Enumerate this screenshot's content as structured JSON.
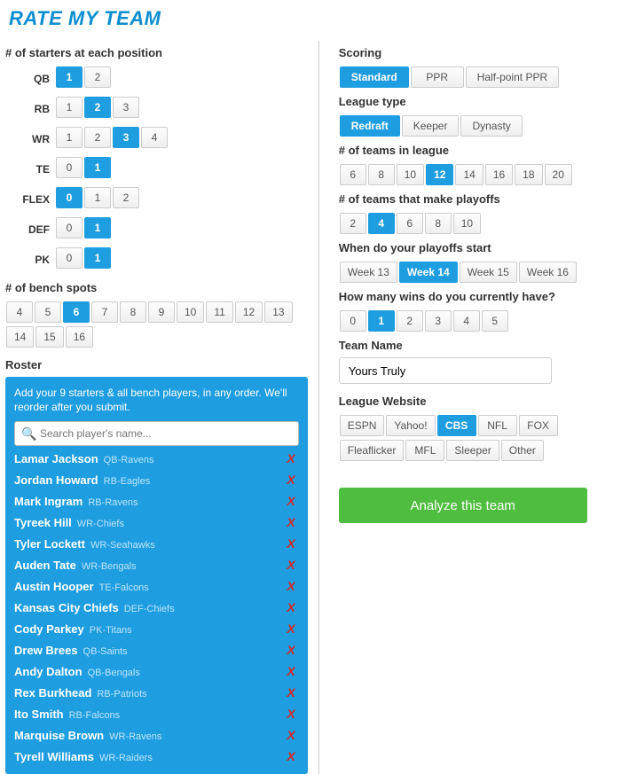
{
  "title": "RATE MY TEAM",
  "left": {
    "starters_label": "# of starters at each position",
    "positions": [
      {
        "name": "QB",
        "options": [
          "1",
          "2"
        ],
        "selected": "1"
      },
      {
        "name": "RB",
        "options": [
          "1",
          "2",
          "3"
        ],
        "selected": "2"
      },
      {
        "name": "WR",
        "options": [
          "1",
          "2",
          "3",
          "4"
        ],
        "selected": "3"
      },
      {
        "name": "TE",
        "options": [
          "0",
          "1"
        ],
        "selected": "1"
      },
      {
        "name": "FLEX",
        "options": [
          "0",
          "1",
          "2"
        ],
        "selected": "0"
      },
      {
        "name": "DEF",
        "options": [
          "0",
          "1"
        ],
        "selected": "1"
      },
      {
        "name": "PK",
        "options": [
          "0",
          "1"
        ],
        "selected": "1"
      }
    ],
    "bench_label": "# of bench spots",
    "bench": {
      "options": [
        "4",
        "5",
        "6",
        "7",
        "8",
        "9",
        "10",
        "11",
        "12",
        "13",
        "14",
        "15",
        "16"
      ],
      "selected": "6"
    },
    "roster_label": "Roster",
    "roster_help": "Add your 9 starters & all bench players, in any order. We'll reorder after you submit.",
    "search_placeholder": "Search player's name...",
    "players": [
      {
        "name": "Lamar Jackson",
        "meta": "QB-Ravens"
      },
      {
        "name": "Jordan Howard",
        "meta": "RB-Eagles"
      },
      {
        "name": "Mark Ingram",
        "meta": "RB-Ravens"
      },
      {
        "name": "Tyreek Hill",
        "meta": "WR-Chiefs"
      },
      {
        "name": "Tyler Lockett",
        "meta": "WR-Seahawks"
      },
      {
        "name": "Auden Tate",
        "meta": "WR-Bengals"
      },
      {
        "name": "Austin Hooper",
        "meta": "TE-Falcons"
      },
      {
        "name": "Kansas City Chiefs",
        "meta": "DEF-Chiefs"
      },
      {
        "name": "Cody Parkey",
        "meta": "PK-Titans"
      },
      {
        "name": "Drew Brees",
        "meta": "QB-Saints"
      },
      {
        "name": "Andy Dalton",
        "meta": "QB-Bengals"
      },
      {
        "name": "Rex Burkhead",
        "meta": "RB-Patriots"
      },
      {
        "name": "Ito Smith",
        "meta": "RB-Falcons"
      },
      {
        "name": "Marquise Brown",
        "meta": "WR-Ravens"
      },
      {
        "name": "Tyrell Williams",
        "meta": "WR-Raiders"
      }
    ]
  },
  "right": {
    "scoring_label": "Scoring",
    "scoring": {
      "options": [
        "Standard",
        "PPR",
        "Half-point PPR"
      ],
      "selected": "Standard"
    },
    "league_type_label": "League type",
    "league_type": {
      "options": [
        "Redraft",
        "Keeper",
        "Dynasty"
      ],
      "selected": "Redraft"
    },
    "teams_label": "# of teams in league",
    "teams": {
      "options": [
        "6",
        "8",
        "10",
        "12",
        "14",
        "16",
        "18",
        "20"
      ],
      "selected": "12"
    },
    "playoffs_label": "# of teams that make playoffs",
    "playoffs": {
      "options": [
        "2",
        "4",
        "6",
        "8",
        "10"
      ],
      "selected": "4"
    },
    "playoff_start_label": "When do your playoffs start",
    "playoff_start": {
      "options": [
        "Week 13",
        "Week 14",
        "Week 15",
        "Week 16"
      ],
      "selected": "Week 14"
    },
    "wins_label": "How many wins do you currently have?",
    "wins": {
      "options": [
        "0",
        "1",
        "2",
        "3",
        "4",
        "5"
      ],
      "selected": "1"
    },
    "team_name_label": "Team Name",
    "team_name_value": "Yours Truly",
    "website_label": "League Website",
    "website": {
      "options": [
        "ESPN",
        "Yahoo!",
        "CBS",
        "NFL",
        "FOX",
        "Fleaflicker",
        "MFL",
        "Sleeper",
        "Other"
      ],
      "selected": "CBS"
    },
    "analyze_label": "Analyze this team"
  }
}
